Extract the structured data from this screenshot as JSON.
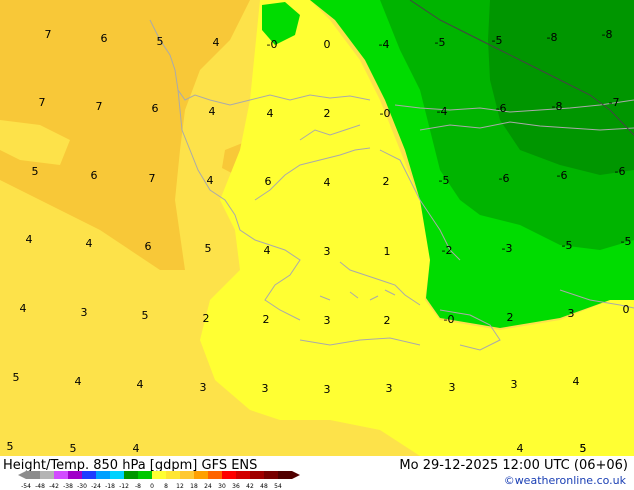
{
  "title": "Height/Temp. 850 hPa [gdpm] GFS ENS",
  "valid_time": "Mo 29-12-2025 12:00 UTC (06+06)",
  "credit": "©weatheronline.co.uk",
  "colorbar": {
    "ticks": [
      "-54",
      "-48",
      "-42",
      "-38",
      "-30",
      "-24",
      "-18",
      "-12",
      "-8",
      "0",
      "8",
      "12",
      "18",
      "24",
      "30",
      "36",
      "42",
      "48",
      "54"
    ],
    "colors": [
      "#8c8c8c",
      "#b4b4b4",
      "#d24bff",
      "#a000c8",
      "#1e3cff",
      "#00a0ff",
      "#00d2ff",
      "#009600",
      "#00c800",
      "#ffff32",
      "#ffe632",
      "#ffc832",
      "#ffa000",
      "#ff6400",
      "#ff0000",
      "#d20000",
      "#a00000",
      "#780000",
      "#500000"
    ]
  },
  "fields": {
    "warm_yellow": "#fde24a",
    "bright_yellow": "#ffff33",
    "orange_yellow": "#f8c838",
    "light_green": "#00dc00",
    "mid_green": "#00b400",
    "dark_green": "#009600",
    "coast": "#aaaaaa"
  },
  "contour_labels": [
    {
      "text": "7"
    },
    {
      "text": "6"
    },
    {
      "text": "5"
    },
    {
      "text": "4"
    },
    {
      "text": "-0"
    },
    {
      "text": "0"
    },
    {
      "text": "-4"
    },
    {
      "text": "-5"
    },
    {
      "text": "-5"
    },
    {
      "text": "-8"
    },
    {
      "text": "-8"
    },
    {
      "text": "7"
    },
    {
      "text": "7"
    },
    {
      "text": "6"
    },
    {
      "text": "4"
    },
    {
      "text": "4"
    },
    {
      "text": "2"
    },
    {
      "text": "-0"
    },
    {
      "text": "-4"
    },
    {
      "text": "-6"
    },
    {
      "text": "-8"
    },
    {
      "text": "-7"
    },
    {
      "text": "5"
    },
    {
      "text": "6"
    },
    {
      "text": "7"
    },
    {
      "text": "4"
    },
    {
      "text": "6"
    },
    {
      "text": "4"
    },
    {
      "text": "2"
    },
    {
      "text": "-5"
    },
    {
      "text": "-6"
    },
    {
      "text": "-6"
    },
    {
      "text": "-6"
    },
    {
      "text": "4"
    },
    {
      "text": "4"
    },
    {
      "text": "6"
    },
    {
      "text": "5"
    },
    {
      "text": "4"
    },
    {
      "text": "3"
    },
    {
      "text": "1"
    },
    {
      "text": "-2"
    },
    {
      "text": "-3"
    },
    {
      "text": "-5"
    },
    {
      "text": "-5"
    },
    {
      "text": "4"
    },
    {
      "text": "3"
    },
    {
      "text": "5"
    },
    {
      "text": "2"
    },
    {
      "text": "2"
    },
    {
      "text": "3"
    },
    {
      "text": "2"
    },
    {
      "text": "-0"
    },
    {
      "text": "2"
    },
    {
      "text": "3"
    },
    {
      "text": "0"
    },
    {
      "text": "5"
    },
    {
      "text": "4"
    },
    {
      "text": "4"
    },
    {
      "text": "3"
    },
    {
      "text": "3"
    },
    {
      "text": "3"
    },
    {
      "text": "3"
    },
    {
      "text": "3"
    },
    {
      "text": "3"
    },
    {
      "text": "4"
    },
    {
      "text": "5"
    },
    {
      "text": "5"
    },
    {
      "text": "4"
    },
    {
      "text": "5"
    },
    {
      "text": "4"
    },
    {
      "text": "5"
    }
  ]
}
